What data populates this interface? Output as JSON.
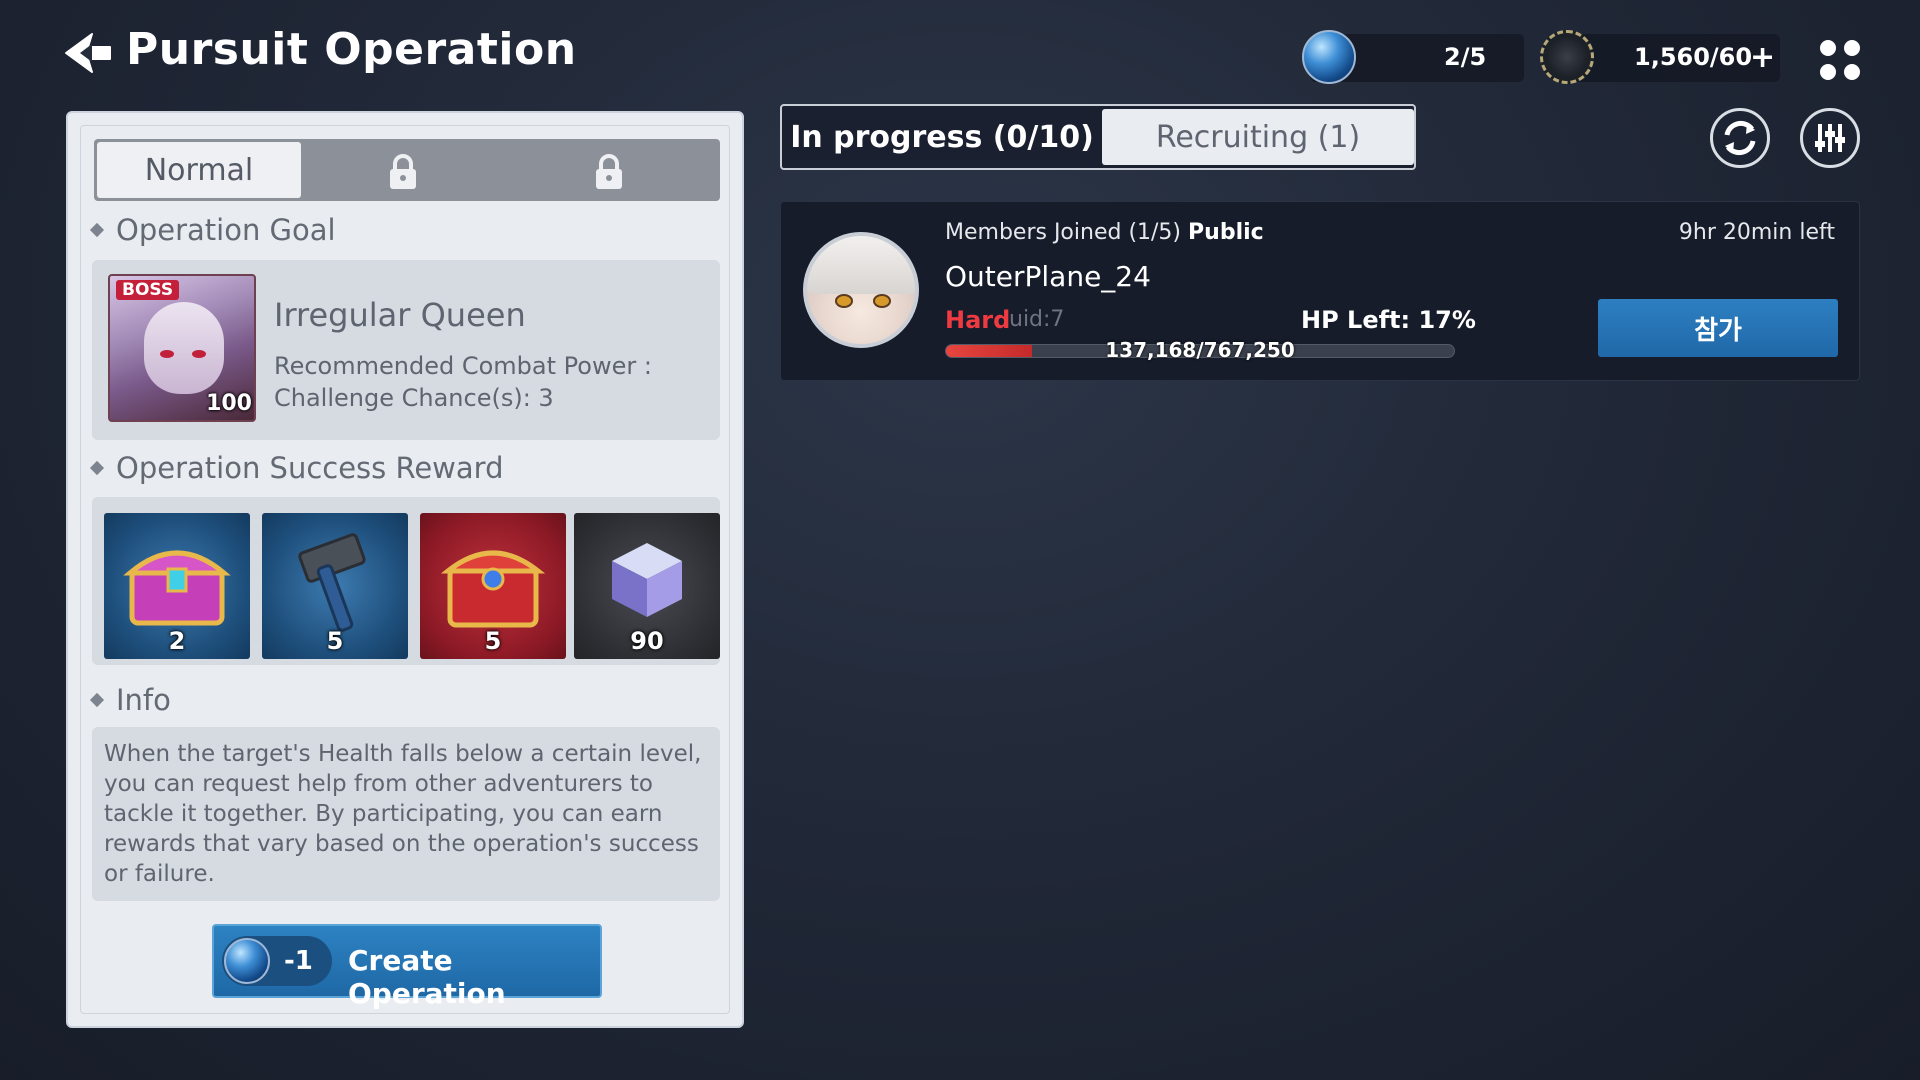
{
  "header": {
    "title": "Pursuit Operation",
    "stamina": {
      "value": "2/5",
      "icon": "blue-orb-icon"
    },
    "gears": {
      "value": "1,560/60",
      "icon": "gear-coin-icon",
      "add_label": "+"
    }
  },
  "left_panel": {
    "difficulty_tabs": [
      {
        "label": "Normal",
        "selected": true,
        "locked": false
      },
      {
        "label": "",
        "selected": false,
        "locked": true
      },
      {
        "label": "",
        "selected": false,
        "locked": true
      }
    ],
    "goal": {
      "section_label": "Operation Goal",
      "boss_badge": "BOSS",
      "boss_level": "100",
      "boss_name": "Irregular Queen",
      "recommended_power_label": "Recommended Combat Power :",
      "challenge_chances": "Challenge Chance(s): 3"
    },
    "reward": {
      "section_label": "Operation Success Reward",
      "items": [
        {
          "icon": "pink-chest-icon",
          "count": "2"
        },
        {
          "icon": "hammer-icon",
          "count": "5"
        },
        {
          "icon": "red-chest-icon",
          "count": "5"
        },
        {
          "icon": "cube-icon",
          "count": "90"
        }
      ]
    },
    "info": {
      "section_label": "Info",
      "text": "When the target's Health falls below a certain level, you can request help from other adventurers to tackle it together. By participating, you can earn rewards that vary based on the operation's success or failure."
    },
    "create_button": {
      "cost": "-1",
      "label": "Create Operation"
    }
  },
  "right_panel": {
    "tabs": [
      {
        "label": "In progress (0/10)",
        "selected": false
      },
      {
        "label": "Recruiting (1)",
        "selected": true
      }
    ],
    "operations": [
      {
        "members": "Members Joined (1/5)",
        "visibility": "Public",
        "time_left": "9hr 20min left",
        "name": "OuterPlane_24",
        "difficulty": "Hard",
        "uid": "uid:7",
        "hp_left": "HP Left: 17%",
        "hp_fraction": 0.17,
        "hp_text": "137,168/767,250",
        "join_label": "참가"
      }
    ]
  },
  "colors": {
    "accent_blue": "#2068a8",
    "hard_red": "#ee3a40",
    "panel_light": "#e9ecf1",
    "background": "#1f2635"
  }
}
